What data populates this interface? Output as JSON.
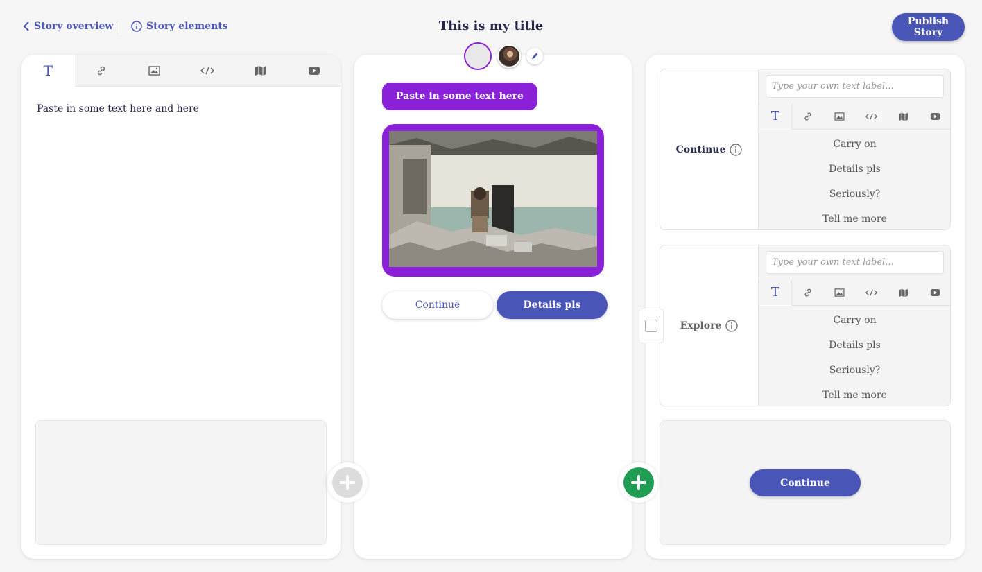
{
  "header": {
    "back_label": "Story overview",
    "elements_label": "Story elements",
    "title": "This is my title",
    "publish_label": "Publish Story"
  },
  "left_panel": {
    "tabs": [
      "T",
      "link-icon",
      "image-icon",
      "code-icon",
      "map-icon",
      "video-icon"
    ],
    "text": "Paste in some text here and here"
  },
  "middle_panel": {
    "bubble_text": "Paste in some text here",
    "buttons": [
      "Continue",
      "Details pls"
    ]
  },
  "right_panel": {
    "choices": [
      {
        "label": "Continue",
        "placeholder": "Type your own text label...",
        "options": [
          "Carry on",
          "Details pls",
          "Seriously?",
          "Tell me more"
        ]
      },
      {
        "label": "Explore",
        "placeholder": "Type your own text label...",
        "options": [
          "Carry on",
          "Details pls",
          "Seriously?",
          "Tell me more"
        ]
      }
    ],
    "continue_label": "Continue"
  },
  "colors": {
    "accent": "#4a55b8",
    "purple": "#8a21d8",
    "green": "#1f9d55"
  }
}
